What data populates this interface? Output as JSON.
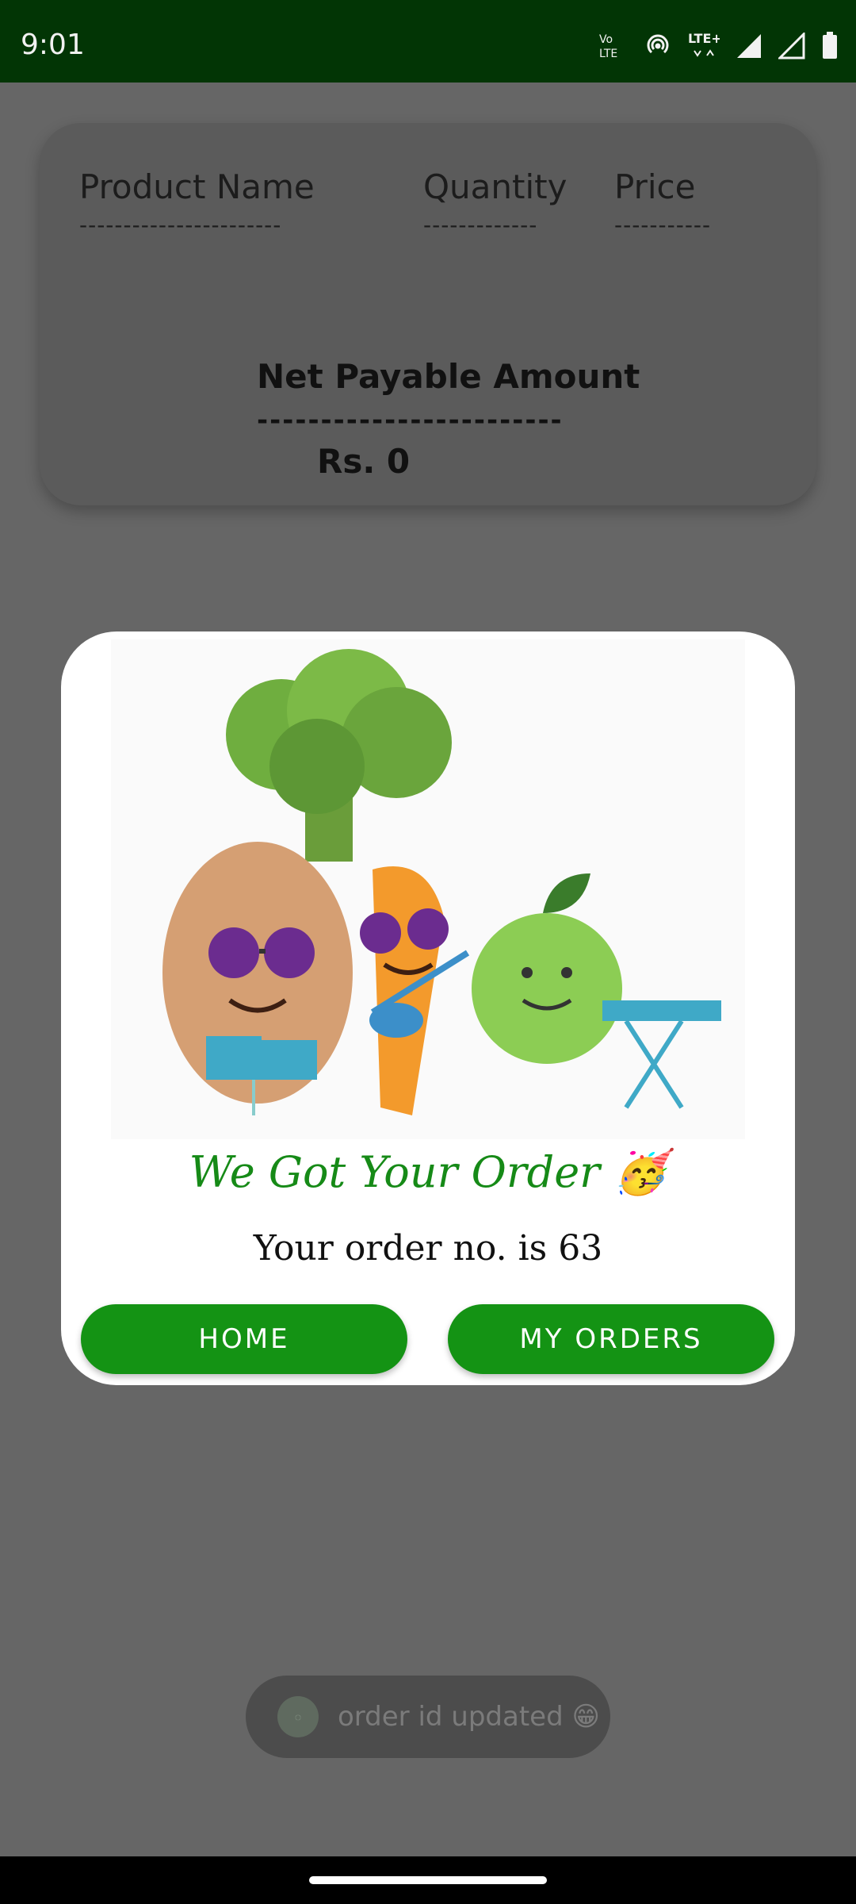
{
  "status_bar": {
    "time": "9:01",
    "icons": [
      "volte-icon",
      "hotspot-icon",
      "lte-plus-icon",
      "signal-icon",
      "signal-icon",
      "battery-icon"
    ]
  },
  "summary": {
    "headers": [
      "Product Name",
      "Quantity",
      "Price"
    ],
    "dashes": [
      "-----------------------",
      "-------------",
      "-----------"
    ],
    "net_label": "Net Payable Amount",
    "net_dash": "------------------------",
    "net_value": "Rs. 0"
  },
  "dialog": {
    "title": "We Got Your Order 🥳",
    "subtitle": "Your order no. is 63",
    "buttons": {
      "home": "HOME",
      "my_orders": "MY ORDERS"
    }
  },
  "toast": {
    "text": "order id updated 😁"
  },
  "colors": {
    "status_bg": "#023505",
    "accent_green": "#149314",
    "title_green": "#168a17"
  }
}
